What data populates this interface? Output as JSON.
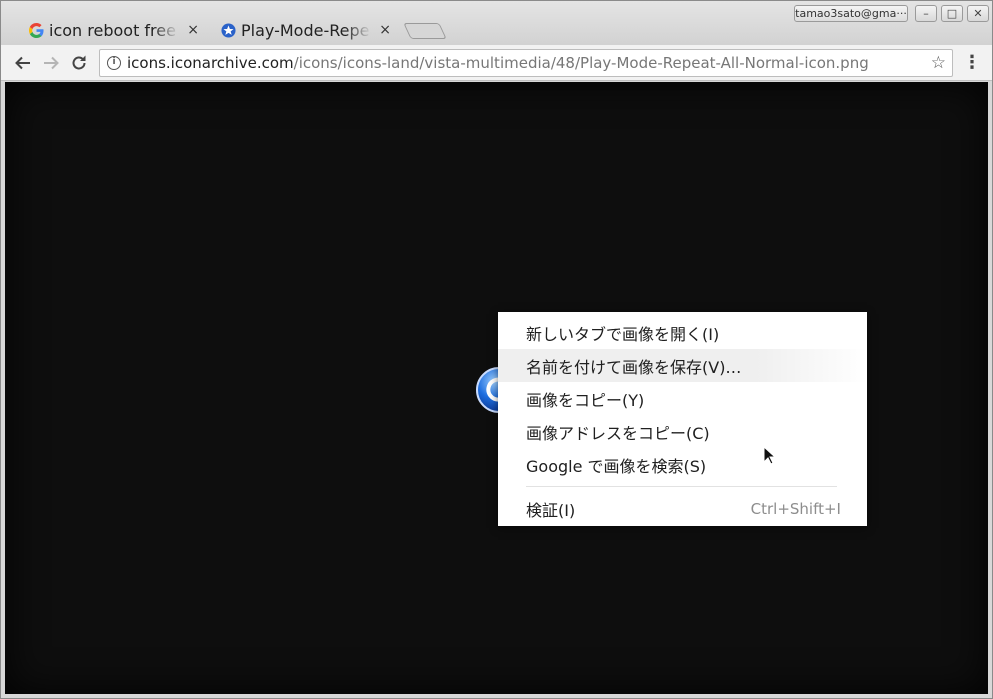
{
  "browser": {
    "tabs": [
      {
        "title": "icon reboot free -",
        "active": false,
        "favicon": "google-g-icon"
      },
      {
        "title": "Play-Mode-Repeat",
        "active": true,
        "favicon": "star-badge-icon"
      }
    ],
    "close_glyph": "×",
    "profile_label": "tamao3sato@gma···",
    "window_controls": {
      "minimize": "–",
      "maximize": "□",
      "close": "✕"
    },
    "address": {
      "host": "icons.iconarchive.com",
      "path": "/icons/icons-land/vista-multimedia/48/Play-Mode-Repeat-All-Normal-icon.png"
    }
  },
  "context_menu": {
    "items": [
      {
        "label": "新しいタブで画像を開く(I)",
        "shortcut": ""
      },
      {
        "label": "名前を付けて画像を保存(V)…",
        "shortcut": "",
        "hovered": true
      },
      {
        "label": "画像をコピー(Y)",
        "shortcut": ""
      },
      {
        "label": "画像アドレスをコピー(C)",
        "shortcut": ""
      },
      {
        "label": "Google で画像を検索(S)",
        "shortcut": ""
      },
      {
        "label": "検証(I)",
        "shortcut": "Ctrl+Shift+I"
      }
    ]
  },
  "colors": {
    "page_background": "#0e0e0e",
    "icon_blue": "#1f6fe0",
    "menu_hover": "#efefef"
  }
}
